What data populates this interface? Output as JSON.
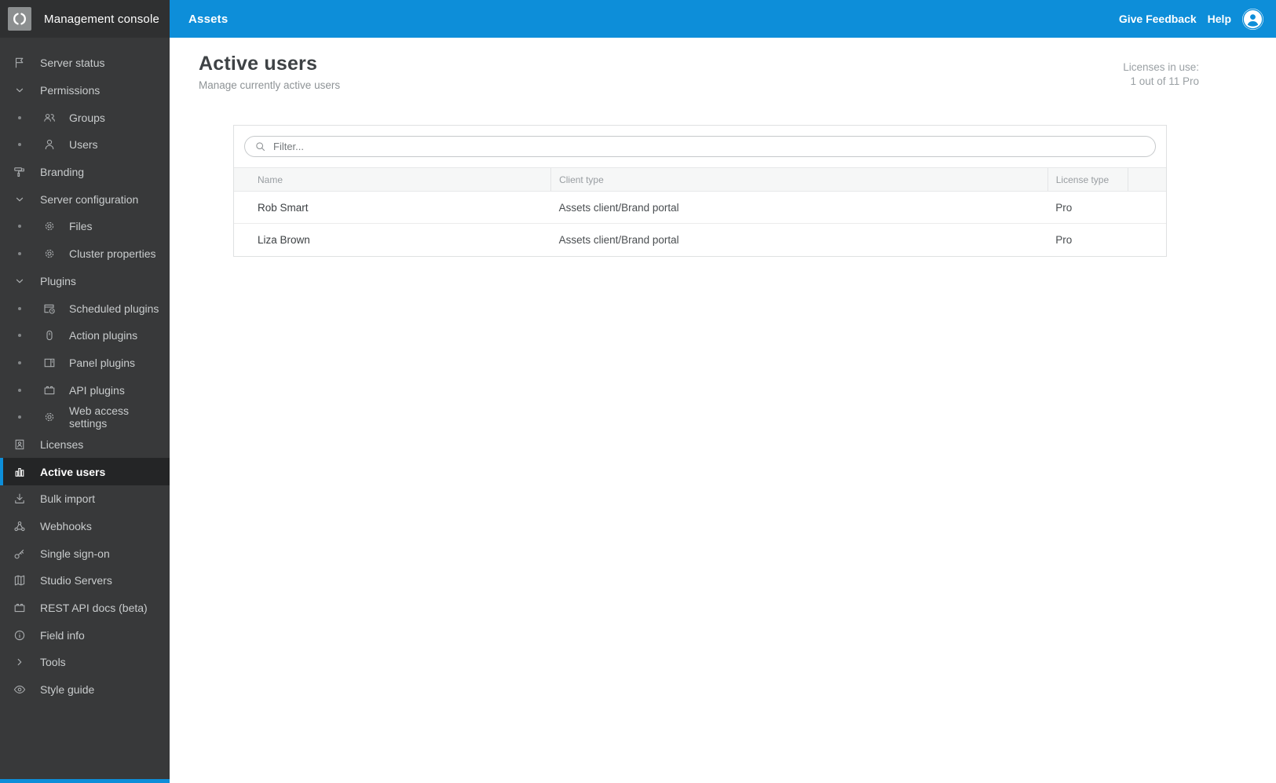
{
  "colors": {
    "accent_blue": "#0d8ed9",
    "sidebar_bg": "#38393a",
    "sidebar_header_bg": "#2f3031",
    "selected_item_bg": "#242526"
  },
  "sidebar": {
    "title": "Management console",
    "items": [
      {
        "label": "Server status",
        "icon": "flag"
      },
      {
        "label": "Permissions",
        "icon": "chevron-down"
      },
      {
        "label": "Groups",
        "icon": "groups"
      },
      {
        "label": "Users",
        "icon": "user"
      },
      {
        "label": "Branding",
        "icon": "paint-roller"
      },
      {
        "label": "Server configuration",
        "icon": "chevron-down"
      },
      {
        "label": "Files",
        "icon": "gear"
      },
      {
        "label": "Cluster properties",
        "icon": "gear"
      },
      {
        "label": "Plugins",
        "icon": "chevron-down"
      },
      {
        "label": "Scheduled plugins",
        "icon": "calendar-clock"
      },
      {
        "label": "Action plugins",
        "icon": "mouse"
      },
      {
        "label": "Panel plugins",
        "icon": "panel"
      },
      {
        "label": "API plugins",
        "icon": "brick"
      },
      {
        "label": "Web access settings",
        "icon": "gear"
      },
      {
        "label": "Licenses",
        "icon": "id-card"
      },
      {
        "label": "Active users",
        "icon": "bar-chart",
        "selected": true
      },
      {
        "label": "Bulk import",
        "icon": "download"
      },
      {
        "label": "Webhooks",
        "icon": "webhook"
      },
      {
        "label": "Single sign-on",
        "icon": "key"
      },
      {
        "label": "Studio Servers",
        "icon": "map"
      },
      {
        "label": "REST API docs (beta)",
        "icon": "brick"
      },
      {
        "label": "Field info",
        "icon": "info"
      },
      {
        "label": "Tools",
        "icon": "chevron-right"
      },
      {
        "label": "Style guide",
        "icon": "eye"
      }
    ]
  },
  "topbar": {
    "app_tab": "Assets",
    "feedback_label": "Give Feedback",
    "help_label": "Help"
  },
  "page": {
    "title": "Active users",
    "subtitle": "Manage currently active users",
    "licenses_line1": "Licenses in use:",
    "licenses_line2": "1 out of 11 Pro"
  },
  "filter": {
    "placeholder": "Filter..."
  },
  "table": {
    "columns": [
      "Name",
      "Client type",
      "License type"
    ],
    "rows": [
      {
        "name": "Rob Smart",
        "client_type": "Assets client/Brand portal",
        "license_type": "Pro"
      },
      {
        "name": "Liza Brown",
        "client_type": "Assets client/Brand portal",
        "license_type": "Pro"
      }
    ]
  }
}
